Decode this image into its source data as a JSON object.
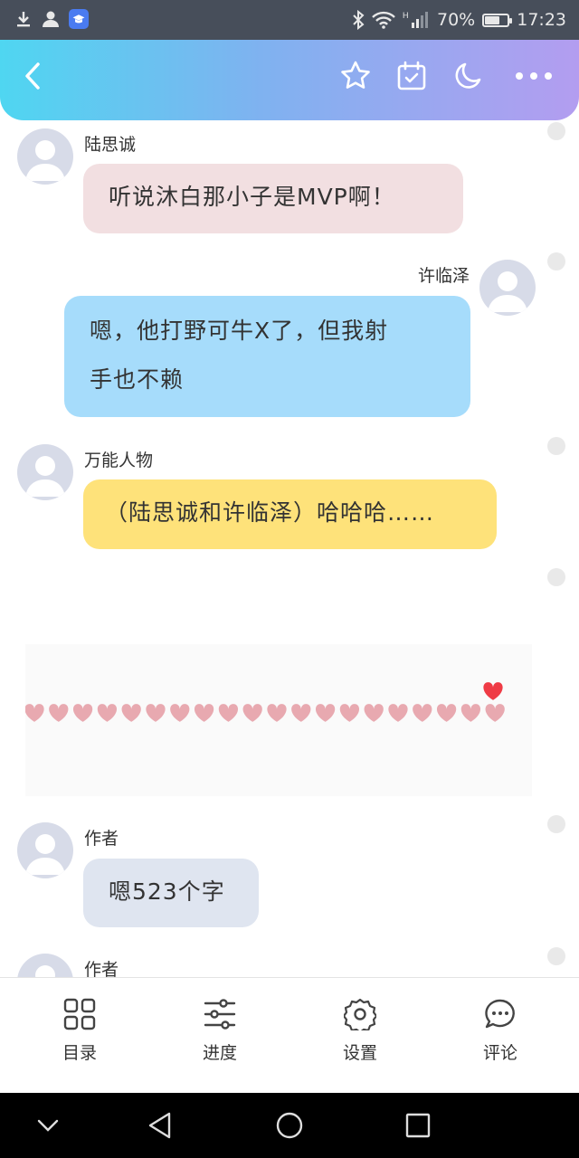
{
  "status_bar": {
    "battery": "70%",
    "time": "17:23",
    "network": "4G"
  },
  "header": {
    "back_icon": "chevron-left-icon",
    "actions": [
      "star-icon",
      "calendar-check-icon",
      "moon-icon",
      "more-icon"
    ]
  },
  "messages": [
    {
      "sender": "陆思诚",
      "text": "听说沐白那小子是MVP啊！",
      "side": "left",
      "color": "#f2dfe1"
    },
    {
      "sender": "许临泽",
      "text_lines": [
        "嗯，他打野可牛X了，但我射",
        "手也不赖"
      ],
      "side": "right",
      "color": "#a6dcfb"
    },
    {
      "sender": "万能人物",
      "text": "（陆思诚和许临泽）哈哈哈……",
      "side": "left",
      "color": "#fee27a"
    },
    {
      "sender": "作者",
      "text": "嗯523个字",
      "side": "left",
      "color": "#dfe5f0"
    },
    {
      "sender": "作者",
      "side": "left"
    }
  ],
  "hearts_image": {
    "heart_count": 21,
    "heart_color": "#e8a9b0",
    "accent_heart_color": "#ef3b45"
  },
  "bottom_nav": [
    {
      "label": "目录",
      "icon": "grid-icon"
    },
    {
      "label": "进度",
      "icon": "sliders-icon"
    },
    {
      "label": "设置",
      "icon": "gear-icon"
    },
    {
      "label": "评论",
      "icon": "comment-icon"
    }
  ],
  "system_nav": [
    "chevron-down-icon",
    "back-triangle-icon",
    "home-circle-icon",
    "recents-square-icon"
  ]
}
